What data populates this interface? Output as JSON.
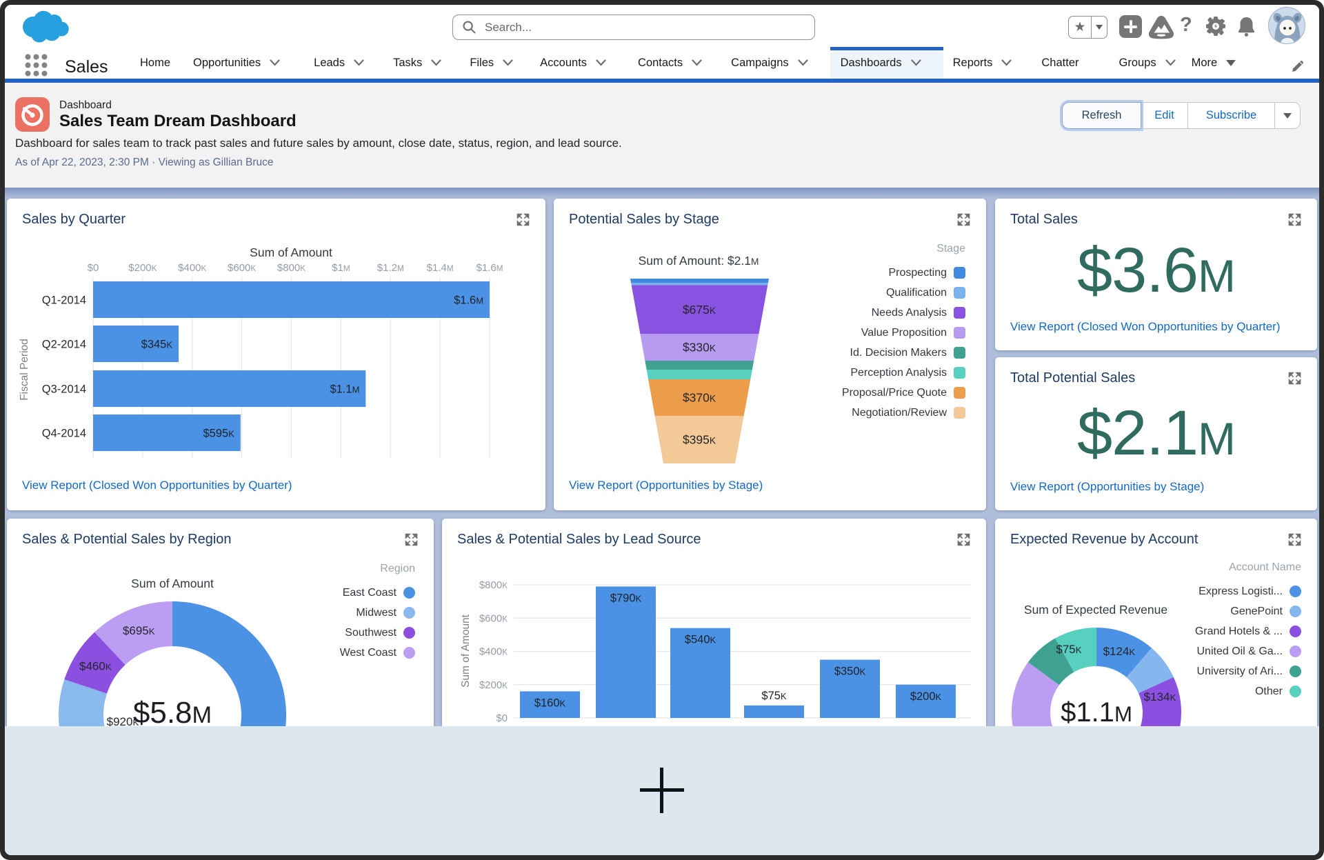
{
  "chrome": {
    "search": {
      "placeholder": "Search..."
    },
    "app_name": "Sales",
    "header_icons": [
      "salesforce-logo",
      "search-icon",
      "star-icon",
      "caret-down-icon",
      "plus-icon",
      "trailhead-guidance-icon",
      "help-icon",
      "setup-gear-icon",
      "notifications-bell-icon",
      "astro-avatar"
    ],
    "nav_icons": [
      "app-launcher-icon",
      "chevron-down-icon",
      "triangle-down-icon",
      "edit-nav-pencil-icon"
    ],
    "colors": {
      "nav_accent": "#2263c3",
      "link_blue": "#1269c7",
      "metric_green": "#2f6b5f",
      "panel_title_navy": "#1d3b63",
      "dashboard_background": "#afbeda",
      "overlay_background": "#dce8ed",
      "frame": "#2b2b2b",
      "dashboard_icon_coral": "#eb7162",
      "logo_blue": "#28a0e0"
    },
    "nav_tabs": [
      {
        "label": "Home",
        "chevron": false,
        "active": false
      },
      {
        "label": "Opportunities",
        "chevron": true,
        "active": false
      },
      {
        "label": "Leads",
        "chevron": true,
        "active": false
      },
      {
        "label": "Tasks",
        "chevron": true,
        "active": false
      },
      {
        "label": "Files",
        "chevron": true,
        "active": false
      },
      {
        "label": "Accounts",
        "chevron": true,
        "active": false
      },
      {
        "label": "Contacts",
        "chevron": true,
        "active": false
      },
      {
        "label": "Campaigns",
        "chevron": true,
        "active": false
      },
      {
        "label": "Dashboards",
        "chevron": true,
        "active": true
      },
      {
        "label": "Reports",
        "chevron": true,
        "active": false
      },
      {
        "label": "Chatter",
        "chevron": false,
        "active": false
      },
      {
        "label": "Groups",
        "chevron": true,
        "active": false
      },
      {
        "label": "More",
        "chevron": false,
        "triangle": true,
        "active": false
      }
    ]
  },
  "dashboard_header": {
    "type_label": "Dashboard",
    "title": "Sales Team Dream Dashboard",
    "description": "Dashboard for sales team to track past sales and future sales by amount, close date, status, region, and lead source.",
    "as_of": "As of Apr 22, 2023, 2:30 PM · Viewing as Gillian Bruce",
    "buttons": {
      "refresh": "Refresh",
      "edit": "Edit",
      "subscribe": "Subscribe"
    }
  },
  "chart_data": [
    {
      "id": "quarter",
      "type": "bar",
      "orientation": "horizontal",
      "title": "Sales by Quarter",
      "chart_title": "Sum of Amount",
      "axis_label": "Fiscal Period",
      "categories": [
        "Q1-2014",
        "Q2-2014",
        "Q3-2014",
        "Q4-2014"
      ],
      "values": [
        1600000,
        345000,
        1100000,
        595000
      ],
      "labels": [
        "$1.6M",
        "$345K",
        "$1.1M",
        "$595K"
      ],
      "x_ticks": [
        "$0",
        "$200K",
        "$400K",
        "$600K",
        "$800K",
        "$1M",
        "$1.2M",
        "$1.4M",
        "$1.6M"
      ],
      "xlim": [
        0,
        1600000
      ],
      "bar_color": "#4b92e5",
      "link": "View Report (Closed Won Opportunities by Quarter)"
    },
    {
      "id": "stage",
      "type": "funnel",
      "title": "Potential Sales by Stage",
      "chart_title": "Sum of Amount: $2.1M",
      "legend_title": "Stage",
      "segments": [
        {
          "label": "Prospecting",
          "value": 60000,
          "display": "",
          "color": "#428adf"
        },
        {
          "label": "Qualification",
          "value": 30000,
          "display": "",
          "color": "#7cb2ec"
        },
        {
          "label": "Needs Analysis",
          "value": 675000,
          "display": "$675K",
          "color": "#8a52e0"
        },
        {
          "label": "Value Proposition",
          "value": 330000,
          "display": "$330K",
          "color": "#b69bef"
        },
        {
          "label": "Id. Decision Makers",
          "value": 120000,
          "display": "",
          "color": "#3fa291"
        },
        {
          "label": "Perception Analysis",
          "value": 120000,
          "display": "",
          "color": "#58d0c0"
        },
        {
          "label": "Proposal/Price Quote",
          "value": 370000,
          "display": "$370K",
          "color": "#eb9d4a"
        },
        {
          "label": "Negotiation/Review",
          "value": 395000,
          "display": "$395K",
          "color": "#f3ca97"
        }
      ],
      "link": "View Report (Opportunities by Stage)"
    },
    {
      "id": "total-sales",
      "type": "metric",
      "title": "Total Sales",
      "value": "$3.6",
      "unit": "M",
      "color": "#2f6b5f",
      "link": "View Report (Closed Won Opportunities by Quarter)"
    },
    {
      "id": "total-potential",
      "type": "metric",
      "title": "Total Potential Sales",
      "value": "$2.1",
      "unit": "M",
      "color": "#2f6b5f",
      "link": "View Report (Opportunities by Stage)"
    },
    {
      "id": "region",
      "type": "donut",
      "title": "Sales & Potential Sales by Region",
      "chart_title": "Sum of Amount",
      "center_label": "$5.8M",
      "legend_title": "Region",
      "slices": [
        {
          "label": "East Coast",
          "value": 3725000,
          "display": "",
          "color": "#4b92e5"
        },
        {
          "label": "Midwest",
          "value": 920000,
          "display": "$920K",
          "color": "#8ab9ee"
        },
        {
          "label": "Southwest",
          "value": 460000,
          "display": "$460K",
          "color": "#8b50e0"
        },
        {
          "label": "West Coast",
          "value": 695000,
          "display": "$695K",
          "color": "#bb9df1"
        }
      ]
    },
    {
      "id": "leadsource",
      "type": "bar",
      "orientation": "vertical",
      "title": "Sales & Potential Sales by Lead Source",
      "axis_label": "Sum of Amount",
      "values": [
        160000,
        790000,
        540000,
        75000,
        350000,
        200000
      ],
      "labels": [
        "$160K",
        "$790K",
        "$540K",
        "$75K",
        "$350K",
        "$200K"
      ],
      "y_ticks": [
        "$800K",
        "$600K",
        "$400K",
        "$200K",
        "$0"
      ],
      "ylim": [
        0,
        800000
      ],
      "bar_color": "#4b92e5"
    },
    {
      "id": "expected",
      "type": "donut",
      "title": "Expected Revenue by Account",
      "chart_title": "Sum of Expected Revenue",
      "center_label": "$1.1M",
      "legend_title": "Account Name",
      "slices": [
        {
          "label": "Express Logisti...",
          "value": 124000,
          "display": "$124K",
          "color": "#4b92e5"
        },
        {
          "label": "GenePoint",
          "value": 76000,
          "display": "",
          "color": "#85b6ee"
        },
        {
          "label": "Grand Hotels & ...",
          "value": 134000,
          "display": "$134K",
          "color": "#8b50e0"
        },
        {
          "label": "United Oil & Ga...",
          "value": 602000,
          "display": "",
          "color": "#bb9df1"
        },
        {
          "label": "University of Ari...",
          "value": 75000,
          "display": "$75K",
          "color": "#3fa291"
        },
        {
          "label": "Other",
          "value": 89000,
          "display": "",
          "color": "#58d0c0"
        }
      ]
    }
  ]
}
